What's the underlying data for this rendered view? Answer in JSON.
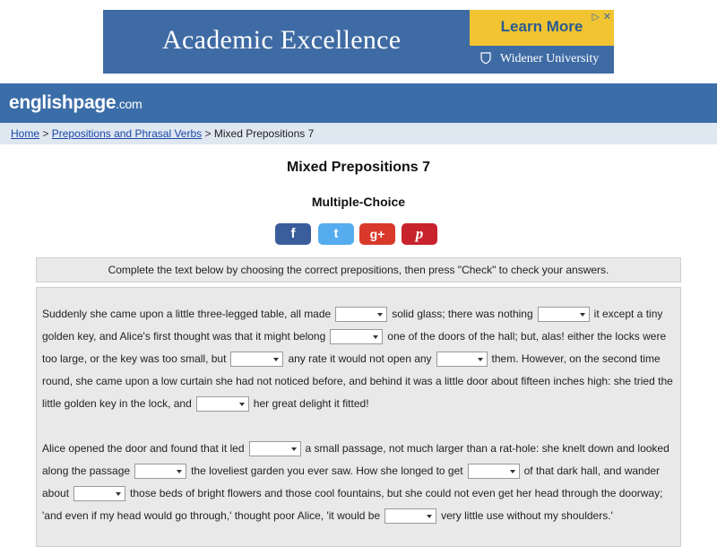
{
  "ad": {
    "headline": "Academic Excellence",
    "cta": "Learn More",
    "university": "Widener University",
    "info_glyph": "▷",
    "close_glyph": "✕",
    "colors": {
      "background": "#3f6ba4",
      "cta": "#f2c431"
    }
  },
  "site": {
    "logo_main": "englishpage",
    "logo_suffix": ".com",
    "header_color": "#3b6da8"
  },
  "breadcrumb": {
    "home": "Home",
    "sep": ">",
    "section": "Prepositions and Phrasal Verbs",
    "current": "Mixed Prepositions 7"
  },
  "page": {
    "title": "Mixed Prepositions 7",
    "subtitle": "Multiple-Choice"
  },
  "share": {
    "facebook": "f",
    "twitter": "t",
    "googleplus": "g+",
    "pinterest": "p"
  },
  "instructions": "Complete the text below by choosing the correct prepositions, then press \"Check\" to check your answers.",
  "exercise": {
    "p1": [
      "Suddenly she came upon a little three-legged table, all made",
      "solid glass; there was nothing",
      "it except a tiny golden key, and Alice's first thought was that it might belong",
      "one of the doors of the hall; but, alas! either the locks were too large, or the key was too small, but",
      "any rate it would not open any",
      "them. However, on the second time round, she came upon a low curtain she had not noticed before, and behind it was a little door about fifteen inches high: she tried the little golden key in the lock, and",
      "her great delight it fitted!"
    ],
    "p2": [
      "Alice opened the door and found that it led",
      "a small passage, not much larger than a rat-hole: she knelt down and looked along the passage",
      "the loveliest garden you ever saw. How she longed to get",
      "of that dark hall, and wander about",
      "those beds of bright flowers and those cool fountains, but she could not even get her head through the doorway;",
      "'and even if my head would go through,' thought poor Alice, 'it would be",
      "very little use without my shoulders.'"
    ]
  }
}
